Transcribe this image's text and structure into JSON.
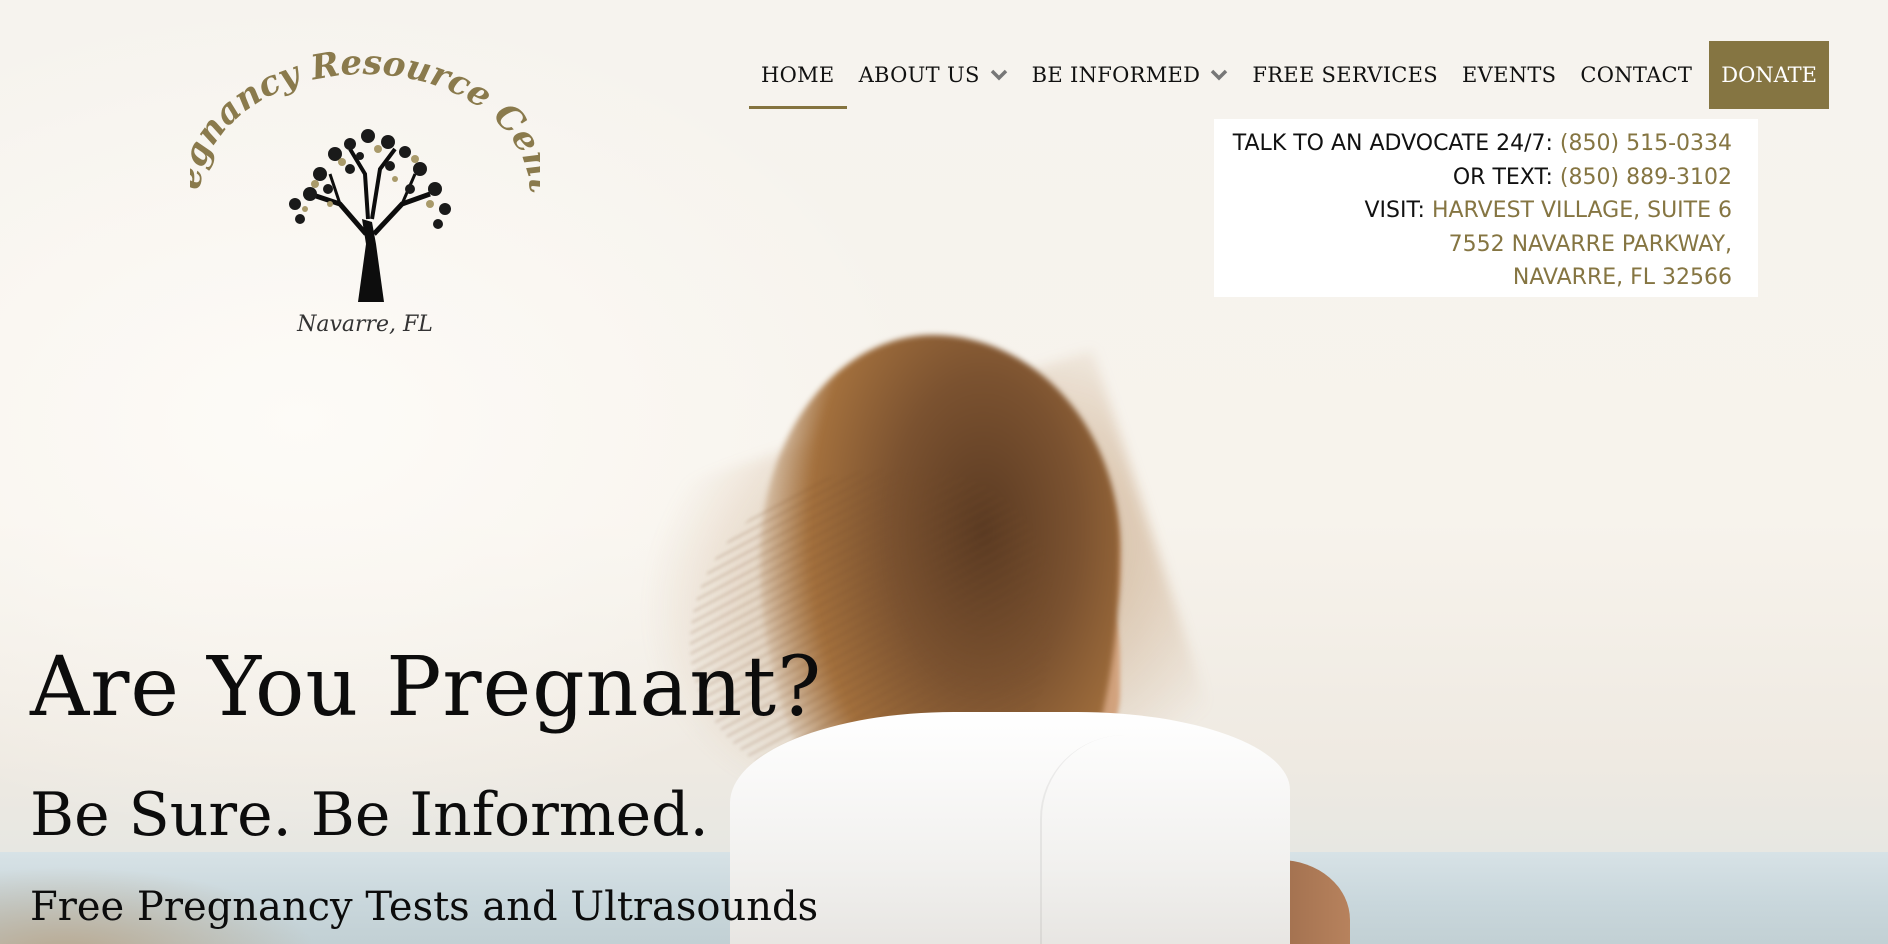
{
  "colors": {
    "accent": "#857542",
    "text": "#111111",
    "contact_bg": "#ffffff"
  },
  "logo": {
    "arc_text": "Pregnancy Resource Center",
    "location_text": "Navarre, FL",
    "icon": "tree-icon"
  },
  "nav": {
    "items": [
      {
        "label": "HOME",
        "active": true
      },
      {
        "label": "ABOUT US",
        "has_dropdown": true
      },
      {
        "label": "BE INFORMED",
        "has_dropdown": true
      },
      {
        "label": "FREE SERVICES"
      },
      {
        "label": "EVENTS"
      },
      {
        "label": "CONTACT"
      }
    ],
    "donate_label": "DONATE"
  },
  "contact": {
    "advocate_label": "TALK TO AN ADVOCATE 24/7:",
    "advocate_phone": "(850) 515-0334",
    "text_label": "OR TEXT:",
    "text_phone": "(850) 889-3102",
    "visit_label": "VISIT:",
    "address_line1": "HARVEST VILLAGE, SUITE 6",
    "address_line2": "7552 NAVARRE PARKWAY,",
    "address_line3": "NAVARRE, FL 32566"
  },
  "hero": {
    "headline": "Are You Pregnant?",
    "subheadline": "Be Sure. Be Informed.",
    "tagline": "Free Pregnancy Tests and Ultrasounds"
  }
}
